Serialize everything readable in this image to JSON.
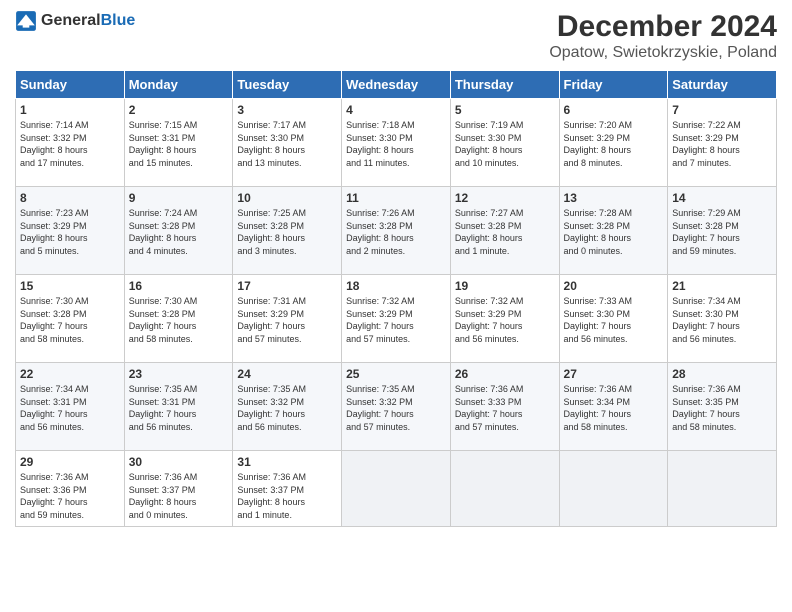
{
  "header": {
    "logo_general": "General",
    "logo_blue": "Blue",
    "title": "December 2024",
    "subtitle": "Opatow, Swietokrzyskie, Poland"
  },
  "columns": [
    "Sunday",
    "Monday",
    "Tuesday",
    "Wednesday",
    "Thursday",
    "Friday",
    "Saturday"
  ],
  "weeks": [
    [
      {
        "day": "1",
        "info": "Sunrise: 7:14 AM\nSunset: 3:32 PM\nDaylight: 8 hours\nand 17 minutes."
      },
      {
        "day": "2",
        "info": "Sunrise: 7:15 AM\nSunset: 3:31 PM\nDaylight: 8 hours\nand 15 minutes."
      },
      {
        "day": "3",
        "info": "Sunrise: 7:17 AM\nSunset: 3:30 PM\nDaylight: 8 hours\nand 13 minutes."
      },
      {
        "day": "4",
        "info": "Sunrise: 7:18 AM\nSunset: 3:30 PM\nDaylight: 8 hours\nand 11 minutes."
      },
      {
        "day": "5",
        "info": "Sunrise: 7:19 AM\nSunset: 3:30 PM\nDaylight: 8 hours\nand 10 minutes."
      },
      {
        "day": "6",
        "info": "Sunrise: 7:20 AM\nSunset: 3:29 PM\nDaylight: 8 hours\nand 8 minutes."
      },
      {
        "day": "7",
        "info": "Sunrise: 7:22 AM\nSunset: 3:29 PM\nDaylight: 8 hours\nand 7 minutes."
      }
    ],
    [
      {
        "day": "8",
        "info": "Sunrise: 7:23 AM\nSunset: 3:29 PM\nDaylight: 8 hours\nand 5 minutes."
      },
      {
        "day": "9",
        "info": "Sunrise: 7:24 AM\nSunset: 3:28 PM\nDaylight: 8 hours\nand 4 minutes."
      },
      {
        "day": "10",
        "info": "Sunrise: 7:25 AM\nSunset: 3:28 PM\nDaylight: 8 hours\nand 3 minutes."
      },
      {
        "day": "11",
        "info": "Sunrise: 7:26 AM\nSunset: 3:28 PM\nDaylight: 8 hours\nand 2 minutes."
      },
      {
        "day": "12",
        "info": "Sunrise: 7:27 AM\nSunset: 3:28 PM\nDaylight: 8 hours\nand 1 minute."
      },
      {
        "day": "13",
        "info": "Sunrise: 7:28 AM\nSunset: 3:28 PM\nDaylight: 8 hours\nand 0 minutes."
      },
      {
        "day": "14",
        "info": "Sunrise: 7:29 AM\nSunset: 3:28 PM\nDaylight: 7 hours\nand 59 minutes."
      }
    ],
    [
      {
        "day": "15",
        "info": "Sunrise: 7:30 AM\nSunset: 3:28 PM\nDaylight: 7 hours\nand 58 minutes."
      },
      {
        "day": "16",
        "info": "Sunrise: 7:30 AM\nSunset: 3:28 PM\nDaylight: 7 hours\nand 58 minutes."
      },
      {
        "day": "17",
        "info": "Sunrise: 7:31 AM\nSunset: 3:29 PM\nDaylight: 7 hours\nand 57 minutes."
      },
      {
        "day": "18",
        "info": "Sunrise: 7:32 AM\nSunset: 3:29 PM\nDaylight: 7 hours\nand 57 minutes."
      },
      {
        "day": "19",
        "info": "Sunrise: 7:32 AM\nSunset: 3:29 PM\nDaylight: 7 hours\nand 56 minutes."
      },
      {
        "day": "20",
        "info": "Sunrise: 7:33 AM\nSunset: 3:30 PM\nDaylight: 7 hours\nand 56 minutes."
      },
      {
        "day": "21",
        "info": "Sunrise: 7:34 AM\nSunset: 3:30 PM\nDaylight: 7 hours\nand 56 minutes."
      }
    ],
    [
      {
        "day": "22",
        "info": "Sunrise: 7:34 AM\nSunset: 3:31 PM\nDaylight: 7 hours\nand 56 minutes."
      },
      {
        "day": "23",
        "info": "Sunrise: 7:35 AM\nSunset: 3:31 PM\nDaylight: 7 hours\nand 56 minutes."
      },
      {
        "day": "24",
        "info": "Sunrise: 7:35 AM\nSunset: 3:32 PM\nDaylight: 7 hours\nand 56 minutes."
      },
      {
        "day": "25",
        "info": "Sunrise: 7:35 AM\nSunset: 3:32 PM\nDaylight: 7 hours\nand 57 minutes."
      },
      {
        "day": "26",
        "info": "Sunrise: 7:36 AM\nSunset: 3:33 PM\nDaylight: 7 hours\nand 57 minutes."
      },
      {
        "day": "27",
        "info": "Sunrise: 7:36 AM\nSunset: 3:34 PM\nDaylight: 7 hours\nand 58 minutes."
      },
      {
        "day": "28",
        "info": "Sunrise: 7:36 AM\nSunset: 3:35 PM\nDaylight: 7 hours\nand 58 minutes."
      }
    ],
    [
      {
        "day": "29",
        "info": "Sunrise: 7:36 AM\nSunset: 3:36 PM\nDaylight: 7 hours\nand 59 minutes."
      },
      {
        "day": "30",
        "info": "Sunrise: 7:36 AM\nSunset: 3:37 PM\nDaylight: 8 hours\nand 0 minutes."
      },
      {
        "day": "31",
        "info": "Sunrise: 7:36 AM\nSunset: 3:37 PM\nDaylight: 8 hours\nand 1 minute."
      },
      null,
      null,
      null,
      null
    ]
  ]
}
